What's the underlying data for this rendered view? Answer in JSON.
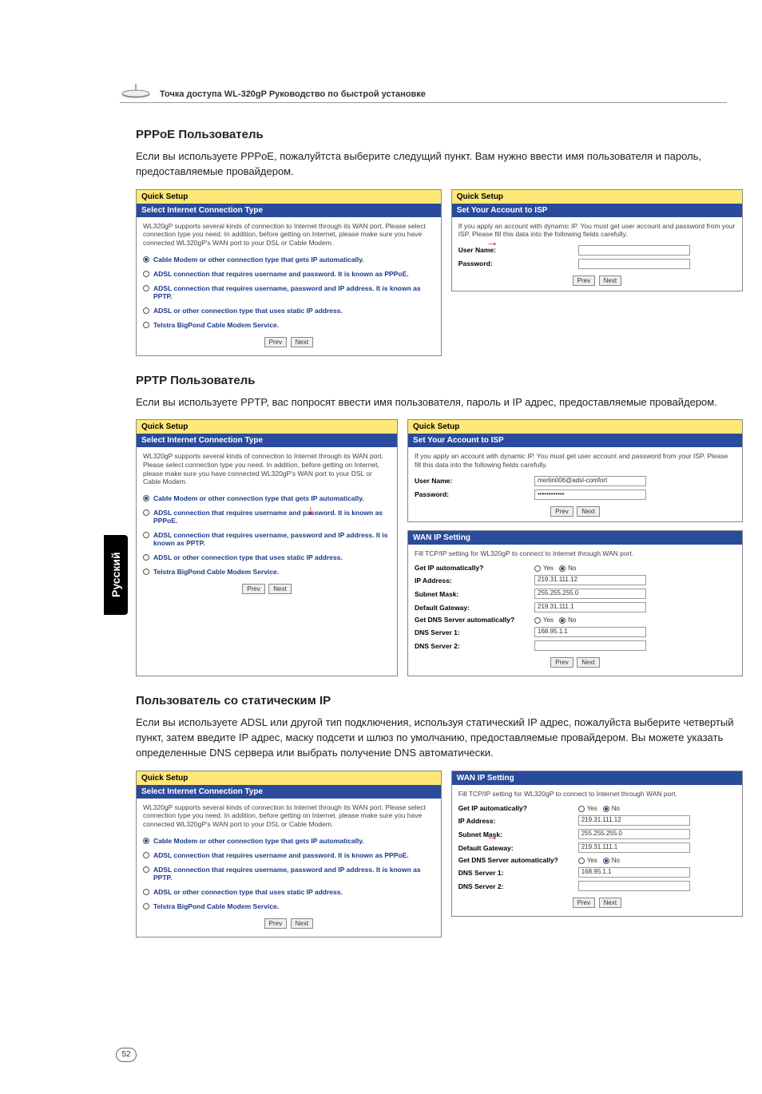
{
  "doc": {
    "title": "Точка доступа WL-320gP Руководство по быстрой установке",
    "pageNumber": "52",
    "sideTab": "Русский"
  },
  "sections": {
    "pppoe": {
      "heading": "PPPoE Пользователь",
      "text": "Если вы используете PPPoE, пожалуйтста выберите следущий пункт. Вам нужно ввести имя пользователя и пароль, предоставляемые провайдером."
    },
    "pptp": {
      "heading": "PPTP Пользователь",
      "text": "Если вы используете PPTP, вас попросят ввести  имя пользователя, пароль и IP адрес, предоставляемые провайдером."
    },
    "static": {
      "heading": "Пользователь со статическим IP",
      "text": "Если вы используете ADSL или другой тип подключения, используя статический IP адрес, пожалуйста выберите четвертый пункт, затем введите IP адрес, маску подсети и шлюз по умолчанию, предоставляемые провайдером. Вы можете указать определенные DNS сервера или выбрать получение DNS автоматически."
    }
  },
  "panelCommon": {
    "quickSetup": "Quick Setup",
    "selectConn": "Select Internet Connection Type",
    "descText": "WL320gP supports several kinds of connection to Internet through its WAN port. Please select connection type you need. In addition, before getting on Internet, please make sure you have connected WL320gP's WAN port to your DSL or Cable Modem.",
    "options": [
      "Cable Modem or other connection type that gets IP automatically.",
      "ADSL connection that requires username and password. It is known as PPPoE.",
      "ADSL connection that requires username, password and IP address. It is known as PPTP.",
      "ADSL or other connection type that uses static IP address.",
      "Telstra BigPond Cable Modem Service."
    ],
    "prev": "Prev",
    "next": "Next"
  },
  "setAccount": {
    "header": "Set Your Account to ISP",
    "desc": "If you apply an account with dynamic IP. You must get user account and password from your ISP. Please fill this data into the following fields carefully.",
    "userName": "User Name:",
    "password": "Password:",
    "userVal": "merlin006@adsl-comfort",
    "passVal": "••••••••••••"
  },
  "wanIp": {
    "header": "WAN IP Setting",
    "desc": "Fill TCP/IP setting for WL320gP to connect to Internet through WAN port.",
    "getIpAuto": "Get IP automatically?",
    "ipAddress": "IP Address:",
    "subnet": "Subnet Mask:",
    "gateway": "Default Gateway:",
    "getDnsAuto": "Get DNS Server automatically?",
    "dns1": "DNS Server 1:",
    "dns2": "DNS Server 2:",
    "ipVal": "219.31.111.12",
    "subnetVal": "255.255.255.0",
    "gatewayVal": "219.31.111.1",
    "dns1Val": "168.95.1.1",
    "yes": "Yes",
    "no": "No"
  }
}
